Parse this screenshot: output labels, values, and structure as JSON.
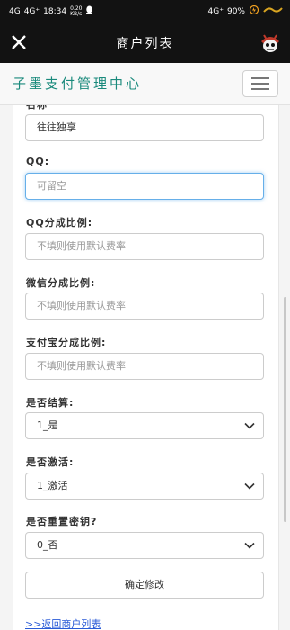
{
  "status": {
    "left": [
      "4G",
      "4G⁺",
      "18:34"
    ],
    "speed": [
      "0.20",
      "KB/s"
    ],
    "right": [
      "4G⁺",
      "90%"
    ]
  },
  "appbar": {
    "title": "商户列表",
    "close_icon": "close-icon",
    "avatar_icon": "skull-avatar-icon"
  },
  "header": {
    "brand": "子墨支付管理中心",
    "menu_icon": "hamburger-menu-icon"
  },
  "form": {
    "name_label": "名称",
    "name_value": "往往独享",
    "qq_label": "QQ:",
    "qq_placeholder": "可留空",
    "qq_ratio_label": "QQ分成比例:",
    "qq_ratio_placeholder": "不填则使用默认费率",
    "wechat_ratio_label": "微信分成比例:",
    "wechat_ratio_placeholder": "不填则使用默认费率",
    "alipay_ratio_label": "支付宝分成比例:",
    "alipay_ratio_placeholder": "不填则使用默认费率",
    "settle_label": "是否结算:",
    "settle_value": "1_是",
    "active_label": "是否激活:",
    "active_value": "1_激活",
    "reset_label": "是否重置密钥?",
    "reset_value": "0_否",
    "submit_label": "确定修改",
    "back_label": ">>返回商户列表"
  }
}
